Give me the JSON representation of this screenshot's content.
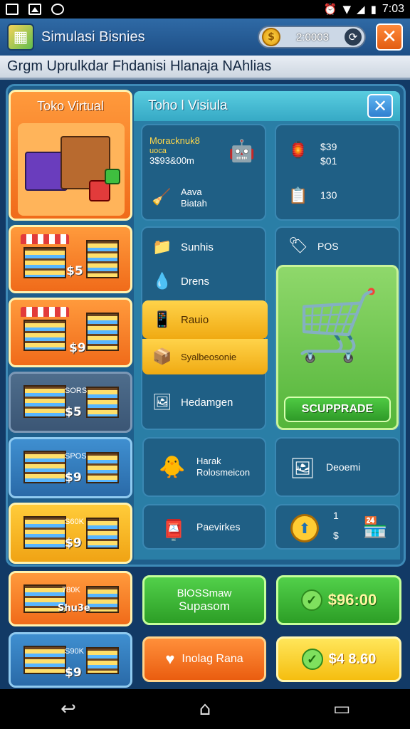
{
  "status_bar": {
    "time": "7:03"
  },
  "header": {
    "title": "Simulasi Bisnies",
    "coins": "2:0003",
    "coin_symbol": "$"
  },
  "banner": {
    "text": "Grgm Uprulkdar Fhdanisi Hlanaja NAhlias"
  },
  "left_tiles": [
    {
      "title": "Toko Virtual"
    },
    {
      "price": "$5"
    },
    {
      "price": "$9"
    },
    {
      "tag": "SORS",
      "price": "$5"
    },
    {
      "tag": "SPOS",
      "price": "$9"
    },
    {
      "tag": "S60K",
      "price": "$9"
    },
    {
      "tag": "780K",
      "price": "Shu3e"
    },
    {
      "tag": "S90K",
      "price": "$9"
    }
  ],
  "panel": {
    "title": "Toho l Visiula",
    "stats_card": {
      "line1": "Moracknuk8",
      "line2": "uoca",
      "line3": "3$93&00m",
      "sub_label": "Aava",
      "sub_label2": "Biatah"
    },
    "value_card": {
      "v1": "$39",
      "v2": "$01",
      "v3": "130"
    },
    "menu": [
      {
        "label": "Sunhis",
        "icon": "clipboard-icon"
      },
      {
        "label": "Drens",
        "icon": "water-drop-icon"
      },
      {
        "label": "Rauio",
        "icon": "tablet-icon"
      },
      {
        "label": "Syalbeosonie",
        "icon": "box-icon"
      },
      {
        "label": "Hedamgen",
        "icon": "picture-icon"
      }
    ],
    "pos_card": {
      "label": "POS",
      "button": "SCUPPRADE"
    },
    "row1": [
      {
        "label": "Harak",
        "label2": "Rolosmeicon"
      },
      {
        "label": "Deoemi"
      }
    ],
    "row2": [
      {
        "label": "Paevirkes"
      },
      {
        "v1": "1",
        "v2": "$"
      }
    ]
  },
  "bottom_buttons": {
    "green_line1": "BlOSSmaw",
    "green_line2": "Supasom",
    "price1": "$96:00",
    "orange_label": "Inolag Rana",
    "price2": "$4 8.60"
  },
  "colors": {
    "accent_orange": "#f06b1a",
    "accent_green": "#2c9e26",
    "accent_yellow": "#f5be10",
    "panel_blue": "#2a7ea6"
  }
}
